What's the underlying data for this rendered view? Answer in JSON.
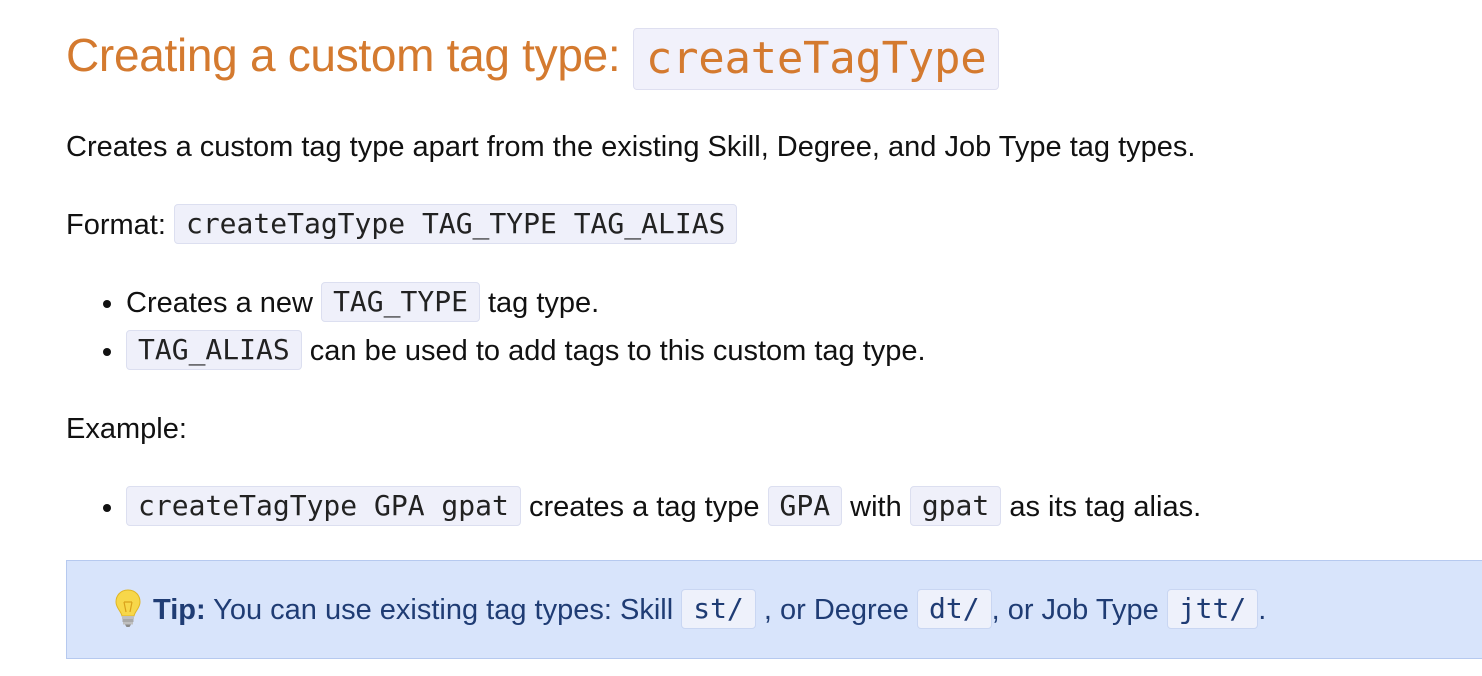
{
  "heading": {
    "text": "Creating a custom tag type:",
    "code": "createTagType"
  },
  "description": "Creates a custom tag type apart from the existing Skill, Degree, and Job Type tag types.",
  "format": {
    "label": "Format:",
    "code": "createTagType TAG_TYPE TAG_ALIAS"
  },
  "bullets": [
    {
      "pre": "Creates a new",
      "code": "TAG_TYPE",
      "post": "tag type."
    },
    {
      "code": "TAG_ALIAS",
      "post": "can be used to add tags to this custom tag type."
    }
  ],
  "example": {
    "label": "Example:",
    "item": {
      "code1": "createTagType GPA gpat",
      "text1": "creates a tag type",
      "code2": "GPA",
      "text2": "with",
      "code3": "gpat",
      "text3": "as its tag alias."
    }
  },
  "tip": {
    "icon": "lightbulb-icon",
    "label": "Tip:",
    "text1": "You can use existing tag types: Skill",
    "code1": "st/",
    "text2": ", or Degree",
    "code2": "dt/",
    "text3": ", or Job Type",
    "code3": "jtt/",
    "text4": "."
  },
  "colors": {
    "heading": "#d47a2f",
    "tip_background": "#d8e4fb",
    "tip_text": "#1f3c74"
  }
}
